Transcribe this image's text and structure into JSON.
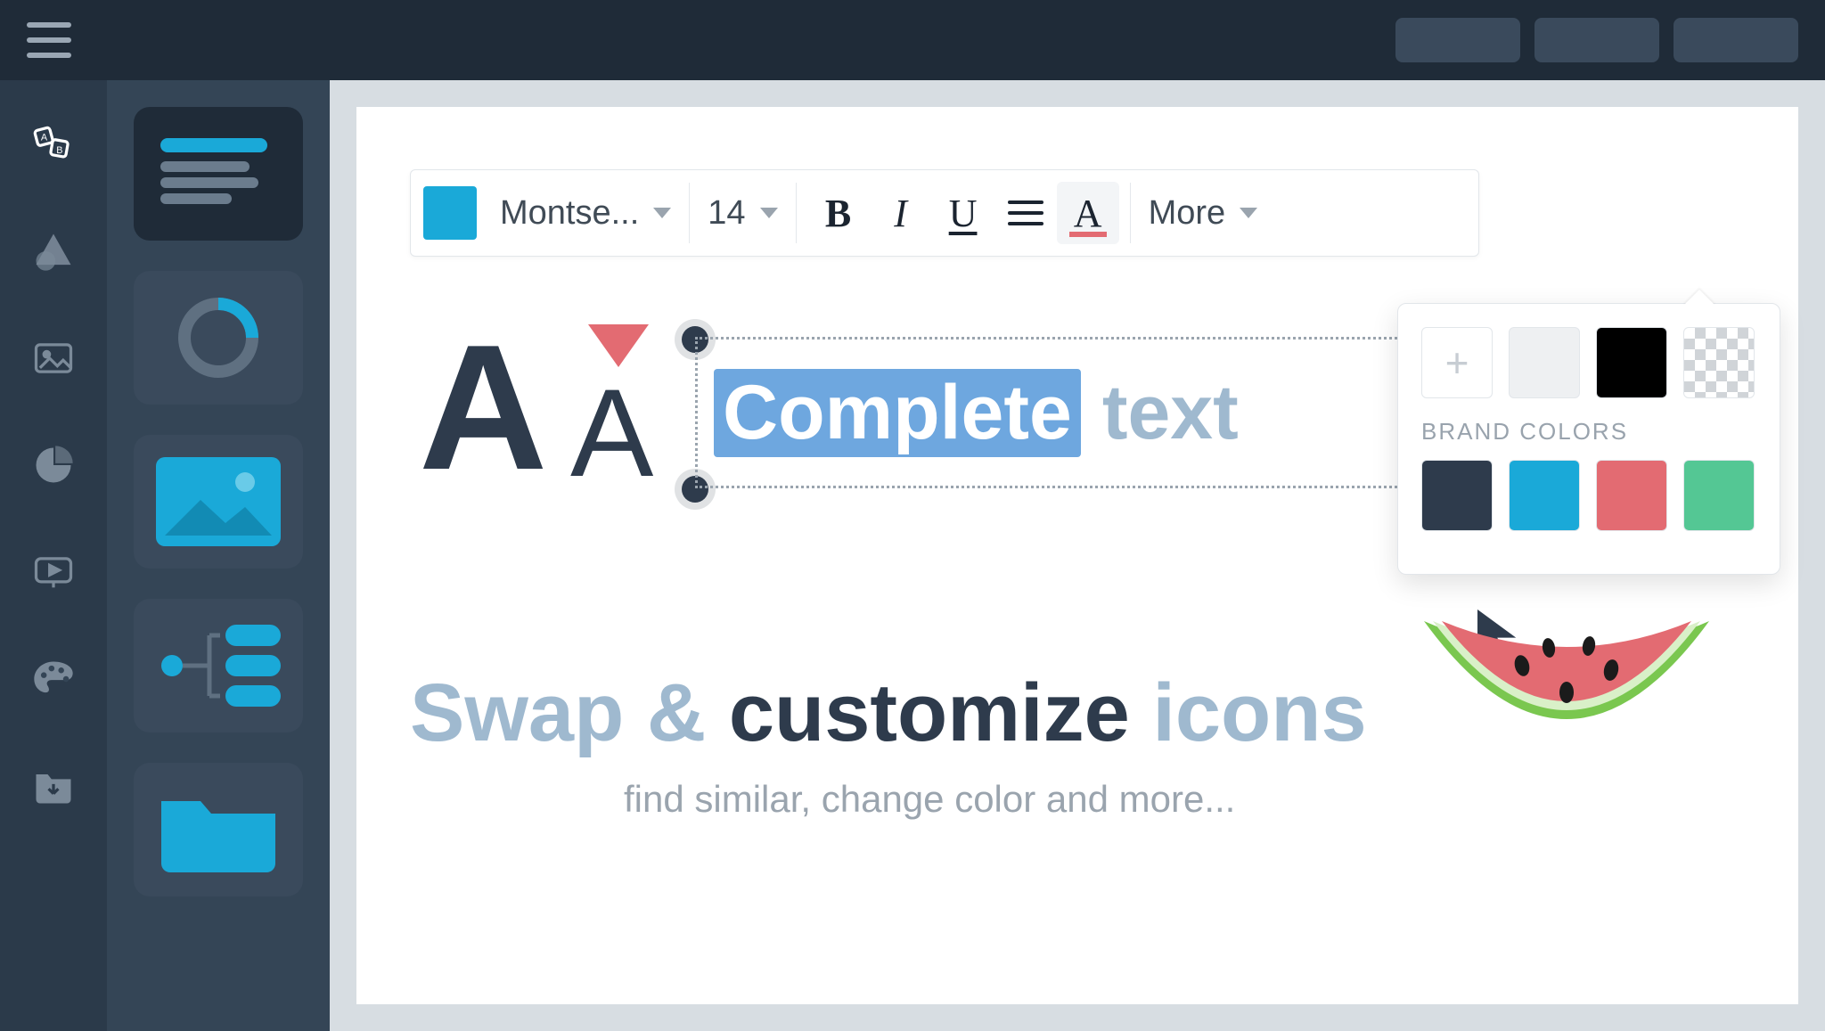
{
  "toolbar": {
    "color_swatch": "#1aa9d8",
    "font": "Montse...",
    "size": "14",
    "bold": "B",
    "italic": "I",
    "underline": "U",
    "textcolor": "A",
    "more": "More"
  },
  "stage": {
    "bigA": "A",
    "smallA": "A",
    "highlighted": "Complete",
    "rest": "text"
  },
  "popover": {
    "label": "BRAND COLORS",
    "top": [
      {
        "name": "add",
        "color": "#ffffff"
      },
      {
        "name": "light",
        "color": "#eef0f2"
      },
      {
        "name": "black",
        "color": "#000000"
      },
      {
        "name": "transparent",
        "color": "checker"
      }
    ],
    "brand": [
      {
        "name": "navy",
        "color": "#2e3b4c"
      },
      {
        "name": "cyan",
        "color": "#1aa9d8"
      },
      {
        "name": "coral",
        "color": "#e36b72"
      },
      {
        "name": "mint",
        "color": "#54c794"
      }
    ]
  },
  "line2": {
    "pre": "Swap & ",
    "strong": "customize",
    "post": " icons"
  },
  "subline": "find similar, change color and more..."
}
